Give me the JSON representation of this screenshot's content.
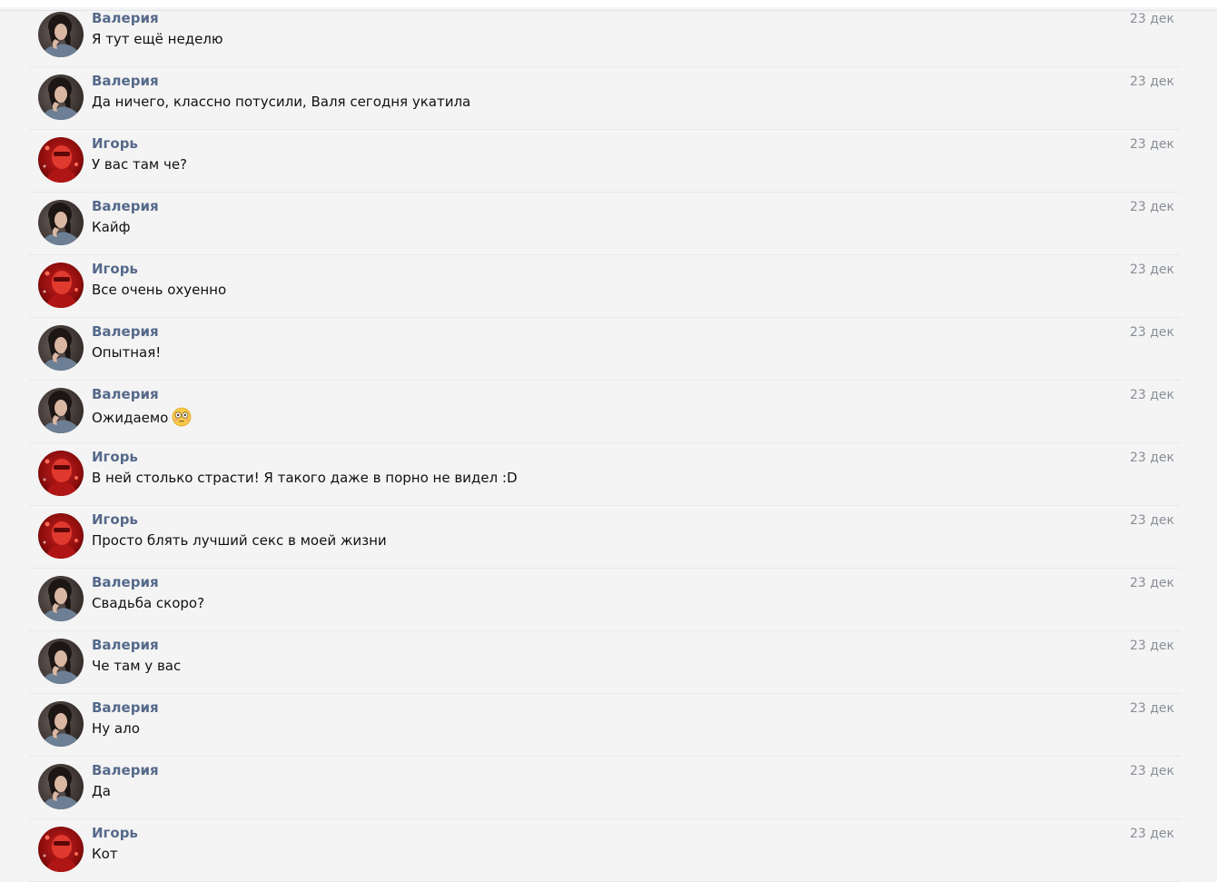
{
  "messages": [
    {
      "author": "Валерия",
      "text": "Я тут ещё неделю",
      "date": "23 дек",
      "avatar": "woman-avatar"
    },
    {
      "author": "Валерия",
      "text": "Да ничего, классно потусили, Валя сегодня укатила",
      "date": "23 дек",
      "avatar": "woman-avatar"
    },
    {
      "author": "Игорь",
      "text": "У вас там че?",
      "date": "23 дек",
      "avatar": "red-avatar"
    },
    {
      "author": "Валерия",
      "text": "Кайф",
      "date": "23 дек",
      "avatar": "woman-avatar"
    },
    {
      "author": "Игорь",
      "text": "Все очень охуенно",
      "date": "23 дек",
      "avatar": "red-avatar"
    },
    {
      "author": "Валерия",
      "text": "Опытная!",
      "date": "23 дек",
      "avatar": "woman-avatar"
    },
    {
      "author": "Валерия",
      "text": "Ожидаемо",
      "date": "23 дек",
      "avatar": "woman-avatar",
      "emoji": "flushed-face-emoji"
    },
    {
      "author": "Игорь",
      "text": "В ней столько страсти! Я такого даже в порно не видел :D",
      "date": "23 дек",
      "avatar": "red-avatar"
    },
    {
      "author": "Игорь",
      "text": "Просто блять лучший секс в моей жизни",
      "date": "23 дек",
      "avatar": "red-avatar"
    },
    {
      "author": "Валерия",
      "text": "Свадьба скоро?",
      "date": "23 дек",
      "avatar": "woman-avatar"
    },
    {
      "author": "Валерия",
      "text": "Че там у вас",
      "date": "23 дек",
      "avatar": "woman-avatar"
    },
    {
      "author": "Валерия",
      "text": "Ну ало",
      "date": "23 дек",
      "avatar": "woman-avatar"
    },
    {
      "author": "Валерия",
      "text": "Да",
      "date": "23 дек",
      "avatar": "woman-avatar"
    },
    {
      "author": "Игорь",
      "text": "Кот",
      "date": "23 дек",
      "avatar": "red-avatar"
    }
  ],
  "colors": {
    "author": "#55698a",
    "text": "#111111",
    "date": "#888e97",
    "background": "#f4f4f4"
  }
}
